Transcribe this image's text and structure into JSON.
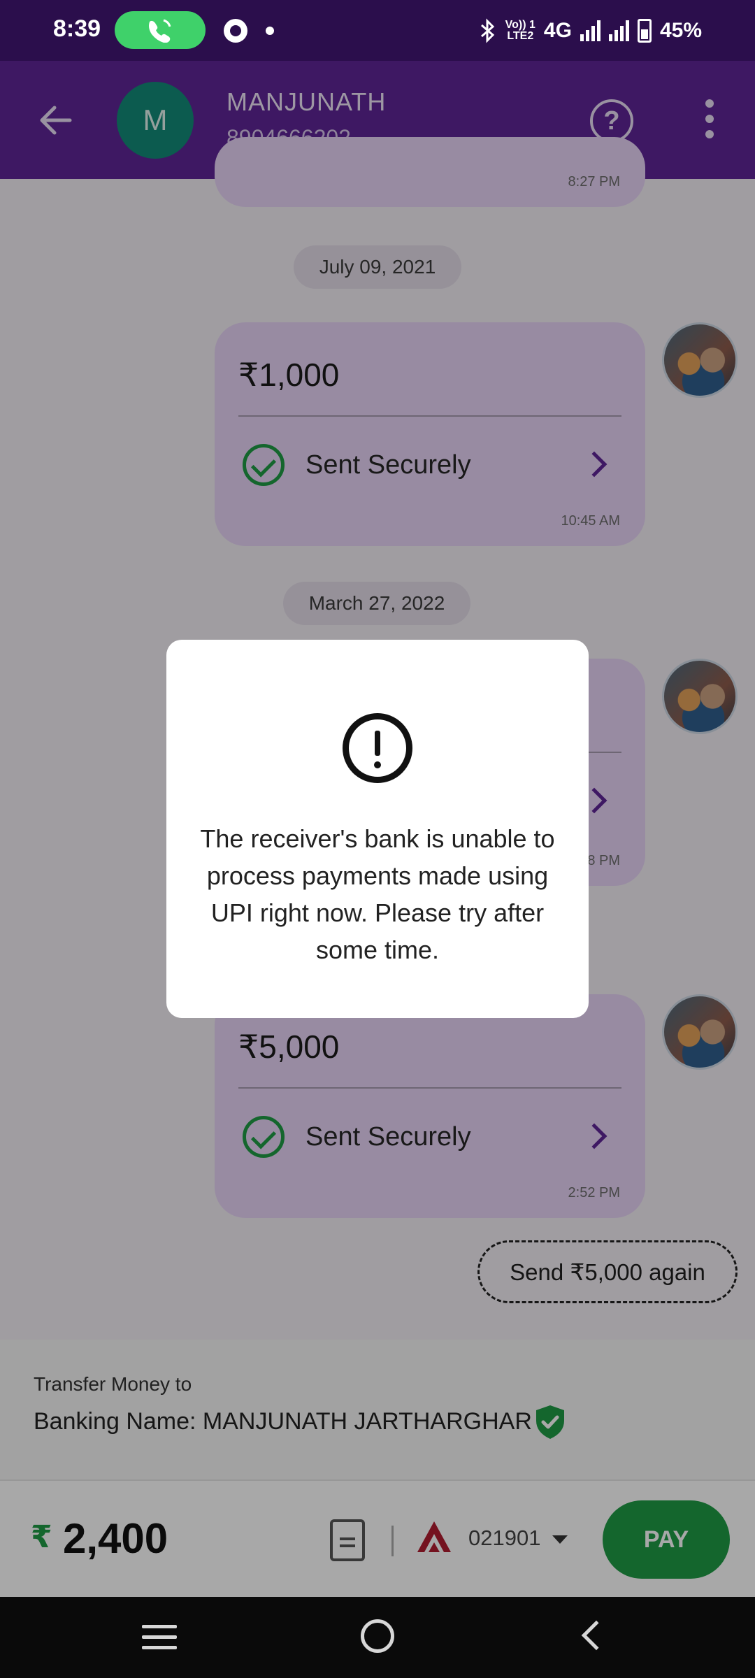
{
  "status_bar": {
    "time": "8:39",
    "network": "4G",
    "volte_top": "Vo)) 1",
    "volte_bottom": "LTE2",
    "battery": "45%"
  },
  "header": {
    "avatar_letter": "M",
    "name": "MANJUNATH",
    "phone": "8904666202"
  },
  "chat": {
    "top_time": "8:27 PM",
    "dates": [
      "July 09, 2021",
      "March 27, 2022"
    ],
    "messages": [
      {
        "amount": "₹1,000",
        "status": "Sent Securely",
        "time": "10:45 AM"
      },
      {
        "amount": "",
        "status": "",
        "time": "8 PM"
      },
      {
        "amount": "₹5,000",
        "status": "Sent Securely",
        "time": "2:52 PM"
      }
    ],
    "send_again": "Send ₹5,000 again"
  },
  "transfer": {
    "label": "Transfer Money to",
    "banking_name": "Banking Name: MANJUNATH JARTHARGHAR"
  },
  "pay_bar": {
    "currency": "₹",
    "amount": "2,400",
    "account": "021901",
    "pay_label": "PAY"
  },
  "dialog": {
    "message": "The receiver's bank is unable to process payments made using UPI right now. Please try after some time."
  },
  "colors": {
    "header": "#5f2597",
    "status_bar": "#2b0e4c",
    "bubble": "#e7d4f6",
    "success": "#1f9b45",
    "bank_logo": "#b01c30"
  }
}
